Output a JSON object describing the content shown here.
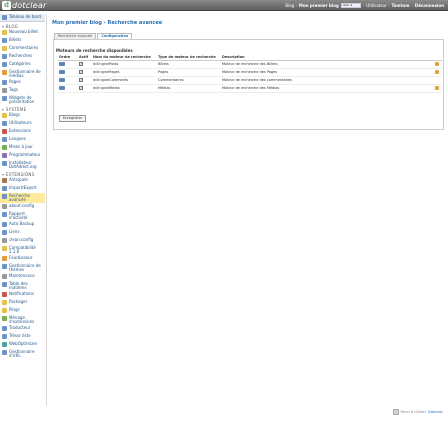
{
  "header": {
    "logo_text": "dotclear",
    "blog_label": "Blog :",
    "blog_name": "Mon premier blog",
    "blog_select_value": "aller à",
    "user_label": "Utilisateur :",
    "user_name": "Tomtom",
    "logout": "Déconnexion"
  },
  "sidebar": {
    "top": "Tableau de bord",
    "section_blog": "BLOG",
    "blog_items": [
      {
        "label": "Nouveau billet",
        "icon": "new-post-icon",
        "color": "i-yellow"
      },
      {
        "label": "Billets",
        "icon": "posts-icon",
        "color": "i-blue"
      },
      {
        "label": "Commentaires",
        "icon": "comments-icon",
        "color": "i-yellow"
      },
      {
        "label": "Recherches",
        "icon": "search-icon",
        "color": "i-blue"
      },
      {
        "label": "Catégories",
        "icon": "categories-icon",
        "color": "i-blue"
      },
      {
        "label": "Gestionnaire de médias",
        "icon": "media-icon",
        "color": "i-orange"
      },
      {
        "label": "Pages",
        "icon": "pages-icon",
        "color": "i-blue"
      },
      {
        "label": "Tags",
        "icon": "tags-icon",
        "color": "i-grey"
      },
      {
        "label": "Widgets de présentation",
        "icon": "widgets-icon",
        "color": "i-blue"
      }
    ],
    "section_system": "SYSTÈME",
    "system_items": [
      {
        "label": "Blogs",
        "icon": "blogs-icon",
        "color": "i-yellow"
      },
      {
        "label": "Utilisateurs",
        "icon": "users-icon",
        "color": "i-blue"
      },
      {
        "label": "Extensions",
        "icon": "plugins-icon",
        "color": "i-red"
      },
      {
        "label": "Langues",
        "icon": "languages-icon",
        "color": "i-blue"
      },
      {
        "label": "Mises à jour",
        "icon": "update-icon",
        "color": "i-green"
      },
      {
        "label": "Programmateur",
        "icon": "scheduler-icon",
        "color": "i-purple"
      },
      {
        "label": "Installateur DotAddict.org",
        "icon": "installer-icon",
        "color": "i-blue"
      }
    ],
    "section_extensions": "EXTENSIONS",
    "extension_items": [
      {
        "label": "Antispam",
        "icon": "antispam-icon",
        "color": "i-brown"
      },
      {
        "label": "Import/Export",
        "icon": "import-export-icon",
        "color": "i-blue"
      },
      {
        "label": "Recherche avancée",
        "icon": "advanced-search-icon",
        "color": "i-blue",
        "selected": true
      },
      {
        "label": "about:config",
        "icon": "config-icon",
        "color": "i-grey"
      },
      {
        "label": "Rapport d'activité",
        "icon": "activity-report-icon",
        "color": "i-blue"
      },
      {
        "label": "Auto Backup",
        "icon": "backup-icon",
        "color": "i-blue"
      },
      {
        "label": "Liens",
        "icon": "links-icon",
        "color": "i-blue"
      },
      {
        "label": "clean:config",
        "icon": "clean-config-icon",
        "color": "i-grey"
      },
      {
        "label": "Compatibilité 2.1.6",
        "icon": "compat-icon",
        "color": "i-yellow"
      },
      {
        "label": "Fourbisseur",
        "icon": "polisher-icon",
        "color": "i-orange"
      },
      {
        "label": "Gestionnaire de thèmes",
        "icon": "themes-icon",
        "color": "i-blue"
      },
      {
        "label": "Maintenance",
        "icon": "maintenance-icon",
        "color": "i-grey"
      },
      {
        "label": "Table des matières",
        "icon": "toc-icon",
        "color": "i-blue"
      },
      {
        "label": "Notifications",
        "icon": "notifications-icon",
        "color": "i-red"
      },
      {
        "label": "Packager",
        "icon": "packager-icon",
        "color": "i-yellow"
      },
      {
        "label": "Pings",
        "icon": "pings-icon",
        "color": "i-yellow"
      },
      {
        "label": "Ménage d'extensions",
        "icon": "cleanup-icon",
        "color": "i-green"
      },
      {
        "label": "Traducteur",
        "icon": "translator-icon",
        "color": "i-blue"
      },
      {
        "label": "Trésor liste",
        "icon": "list-icon",
        "color": "i-blue"
      },
      {
        "label": "WebOptimizer",
        "icon": "optimizer-icon",
        "color": "i-teal"
      },
      {
        "label": "Gestionnaire d'URL",
        "icon": "url-icon",
        "color": "i-blue"
      }
    ]
  },
  "main": {
    "breadcrumb_blog": "Mon premier blog",
    "breadcrumb_sep": "›",
    "breadcrumb_page": "Recherche avancée",
    "tabs": [
      "Recherche avancée",
      "Configuration"
    ],
    "fieldset_title": "Moteurs de recherche disponibles",
    "columns": [
      "Ordre",
      "Actif",
      "Nom du moteur de recherche",
      "Type de moteur de recherche",
      "Description"
    ],
    "rows": [
      {
        "name": "dcEnginePosts",
        "type": "Billets",
        "description": "Moteur de recherche des Billets",
        "editable": true
      },
      {
        "name": "dcEnginePages",
        "type": "Pages",
        "description": "Moteur de recherche des Pages",
        "editable": true
      },
      {
        "name": "dcEngineComments",
        "type": "Commentaires",
        "description": "Moteur de recherche des commentaires",
        "editable": false
      },
      {
        "name": "dcEngineMedia",
        "type": "Médias",
        "description": "Moteur de recherche des Médias",
        "editable": true
      }
    ],
    "save_label": "Enregistrer"
  },
  "footer": {
    "text": "Merci d'utiliser",
    "link": "Dotclear"
  }
}
